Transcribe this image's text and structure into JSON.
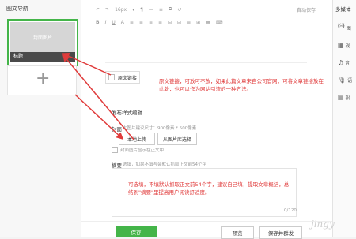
{
  "sidebar": {
    "title": "图文导航",
    "cover_placeholder": "封面图片",
    "cover_title": "标题",
    "add_symbol": "+"
  },
  "editor": {
    "toolbar_row1": [
      "↶",
      "↷",
      "16px",
      "▾",
      "¶",
      "—",
      "≡",
      "⧉",
      "↺"
    ],
    "autosave": "自动保存",
    "toolbar_row2": [
      "B",
      "I",
      "U",
      "A",
      "≡",
      "≡",
      "≡",
      "≡",
      "⊟",
      "⊟",
      "≡",
      "⊞",
      "▦",
      "⌨"
    ],
    "original_link_label": "原文链接",
    "original_link_annotation": "原文链接，可放可不放，如果此篇文章来自公司官网，可将文章链接放在此处，也可以作为网站引流的一种方法。",
    "publish_heading": "发布样式编辑",
    "cover_label": "封面",
    "cover_hint": "大图片建议尺寸：900像素 * 500像素",
    "upload_local": "本地上传",
    "from_library": "从图片库选择",
    "cover_show_label": "封面图片显示在正文中",
    "abstract_label": "摘要",
    "abstract_hint": "选填，如果不填写会默认抓取正文前54个字",
    "abstract_annotation": "可选填，不填默认抓取正文前54个字，建议自己填，提取文章概括，总结到\"摘要\"里提高用户阅读舒适度。",
    "abstract_count": "0/120"
  },
  "bottom": {
    "save": "保存",
    "preview": "预览",
    "save_send": "保存并群发"
  },
  "right_panel": {
    "title": "多媒体",
    "items": [
      {
        "icon": "🖾",
        "label": "图"
      },
      {
        "icon": "▦",
        "label": "视"
      },
      {
        "icon": "♫",
        "label": "音"
      },
      {
        "icon": "🎙",
        "label": "语"
      },
      {
        "icon": "▤",
        "label": "投"
      }
    ]
  },
  "watermark": "jingy",
  "colors": {
    "accent_green": "#44b549",
    "annotation_red": "#e03b3b"
  }
}
